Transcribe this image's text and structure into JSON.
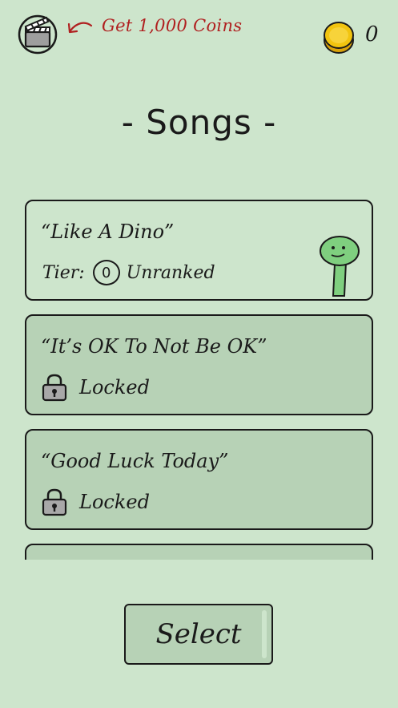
{
  "header": {
    "ad_offer_label": "Get 1,000 Coins",
    "coin_count": "0",
    "icons": {
      "ad": "clapperboard-icon",
      "arrow": "curved-arrow-icon",
      "coin": "coin-icon"
    }
  },
  "page_title": "- Songs -",
  "songs": [
    {
      "title": "“Like A Dino”",
      "tier_label": "Tier:",
      "tier_badge": "0",
      "tier_name": "Unranked",
      "locked": false
    },
    {
      "title": "“It’s OK To Not Be OK”",
      "status": "Locked",
      "locked": true
    },
    {
      "title": "“Good Luck Today”",
      "status": "Locked",
      "locked": true
    }
  ],
  "select_label": "Select",
  "colors": {
    "background": "#cde5cc",
    "locked_card": "#b7d2b6",
    "accent_text": "#b02020",
    "coin": "#f2c40f",
    "dino": "#7fcf7f"
  }
}
